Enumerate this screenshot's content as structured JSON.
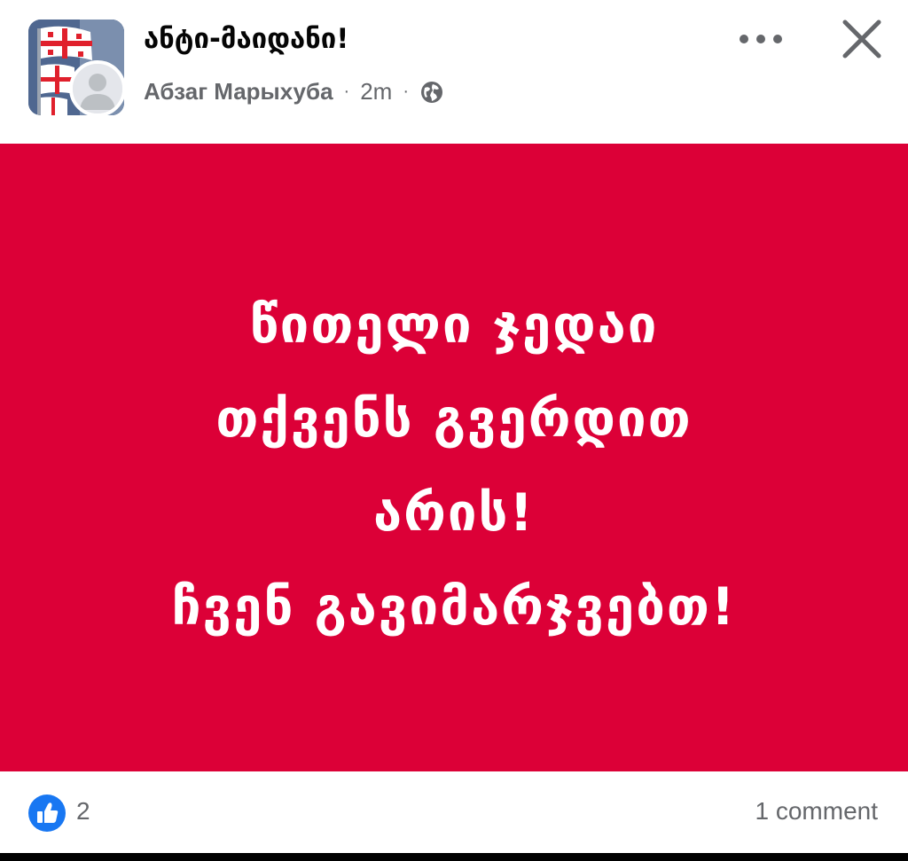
{
  "header": {
    "group_name": "ანტი-მაიდანი!",
    "author": "Абзаг Марыхуба",
    "separator": "·",
    "time": "2m",
    "privacy_icon": "globe-icon",
    "more_icon": "more-options-icon",
    "close_icon": "close-icon"
  },
  "post_image": {
    "background_color": "#dc0037",
    "text_color": "#ffffff",
    "lines": [
      "წითელი ჯედაი",
      "თქვენს გვერდით",
      "არის!",
      "ჩვენ გავიმარჯვებთ!"
    ]
  },
  "footer": {
    "like_icon": "like-thumbs-up-icon",
    "like_count": "2",
    "comments_label": "1 comment"
  },
  "colors": {
    "accent_blue": "#1877f2",
    "muted_text": "#65676b",
    "primary_text": "#050505"
  }
}
